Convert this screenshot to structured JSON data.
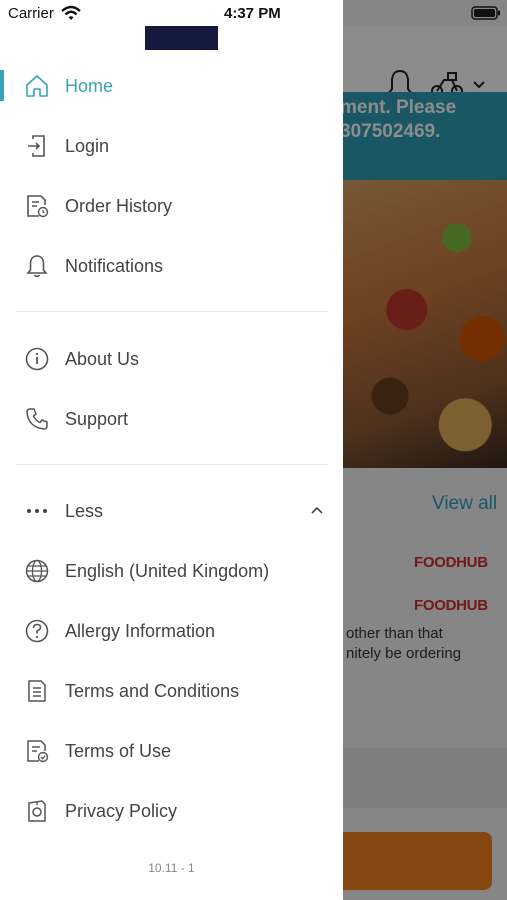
{
  "status_bar": {
    "carrier": "Carrier",
    "time": "4:37 PM"
  },
  "drawer": {
    "primary_items": [
      {
        "label": "Home",
        "icon": "home-icon",
        "active": true
      },
      {
        "label": "Login",
        "icon": "login-icon"
      },
      {
        "label": "Order History",
        "icon": "order-history-icon"
      },
      {
        "label": "Notifications",
        "icon": "bell-icon"
      }
    ],
    "secondary_items": [
      {
        "label": "About Us",
        "icon": "info-icon"
      },
      {
        "label": "Support",
        "icon": "phone-icon"
      }
    ],
    "more_toggle": {
      "label": "Less",
      "icon": "more-dots-icon",
      "state": "expanded"
    },
    "more_items": [
      {
        "label": "English (United Kingdom)",
        "icon": "globe-icon"
      },
      {
        "label": "Allergy Information",
        "icon": "question-icon"
      },
      {
        "label": "Terms and Conditions",
        "icon": "document-icon"
      },
      {
        "label": "Terms of Use",
        "icon": "document-check-icon"
      },
      {
        "label": "Privacy Policy",
        "icon": "privacy-icon"
      }
    ],
    "version": "10.11 - 1",
    "accent_color": "#3ba3b8"
  },
  "background": {
    "banner_text": "ment. Please\n307502469.",
    "view_all": "View all",
    "brand_1": "FOODHUB",
    "brand_2": "FOODHUB",
    "desc_line_1": "other than that",
    "desc_line_2": "nitely be ordering"
  }
}
